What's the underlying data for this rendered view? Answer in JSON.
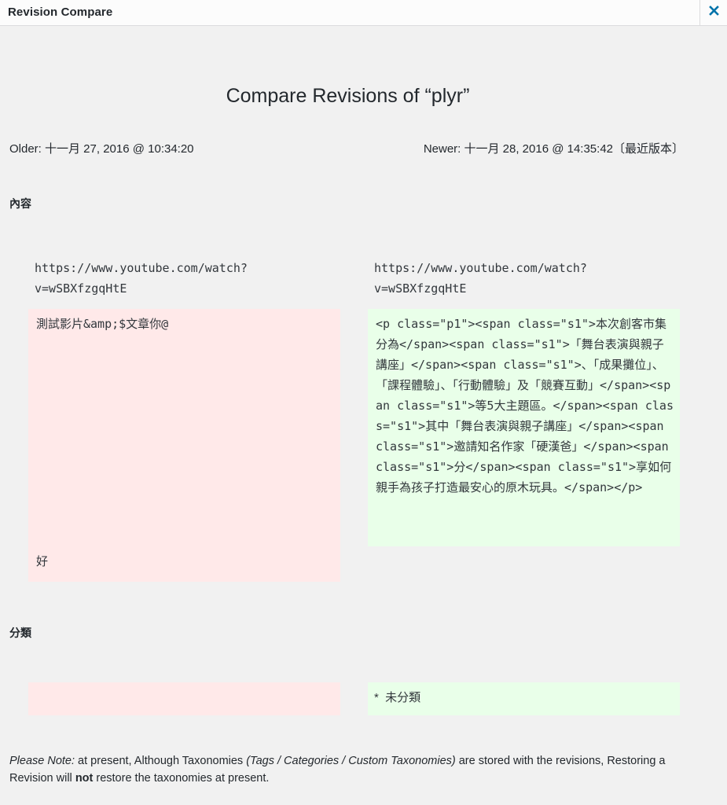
{
  "header": {
    "title": "Revision Compare",
    "close_icon": "close-x-icon",
    "accent_color": "#0073aa"
  },
  "page": {
    "title": "Compare Revisions of “plyr”"
  },
  "meta": {
    "older": "Older: 十一月 27, 2016 @ 10:34:20",
    "newer": "Newer: 十一月 28, 2016 @ 14:35:42〔最近版本〕"
  },
  "sections": {
    "content": {
      "label": "內容",
      "context_lines": [
        "https://www.youtube.com/watch?",
        "v=wSBXfzgqHtE"
      ],
      "deleted_lines": [
        "測試影片&amp;$文章你@",
        "好"
      ],
      "added_text": "<p class=\"p1\"><span class=\"s1\">本次創客市集分為</span><span class=\"s1\">「舞台表演與親子講座」</span><span class=\"s1\">、「成果攤位」、「課程體驗」、「行動體驗」及「競賽互動」</span><span class=\"s1\">等5大主題區。</span><span class=\"s1\">其中「舞台表演與親子講座」</span><span class=\"s1\">邀請知名作家「硬漢爸」</span><span class=\"s1\">分</span><span class=\"s1\">享如何親手為孩子打造最安心的原木玩具。</span></p>"
    },
    "category": {
      "label": "分類",
      "deleted_value": "",
      "added_value": "*  未分類"
    }
  },
  "note": {
    "prefix_italic": "Please Note:",
    "part1": " at present, Although Taxonomies ",
    "italic_mid": "(Tags / Categories / Custom Taxonomies)",
    "part2": " are stored with the revisions, Restoring a Revision will ",
    "bold": "not",
    "part3": " restore the taxonomies at present."
  },
  "colors": {
    "deleted_bg": "#ffe9e9",
    "added_bg": "#e9ffe9",
    "page_bg": "#f1f1f1"
  }
}
